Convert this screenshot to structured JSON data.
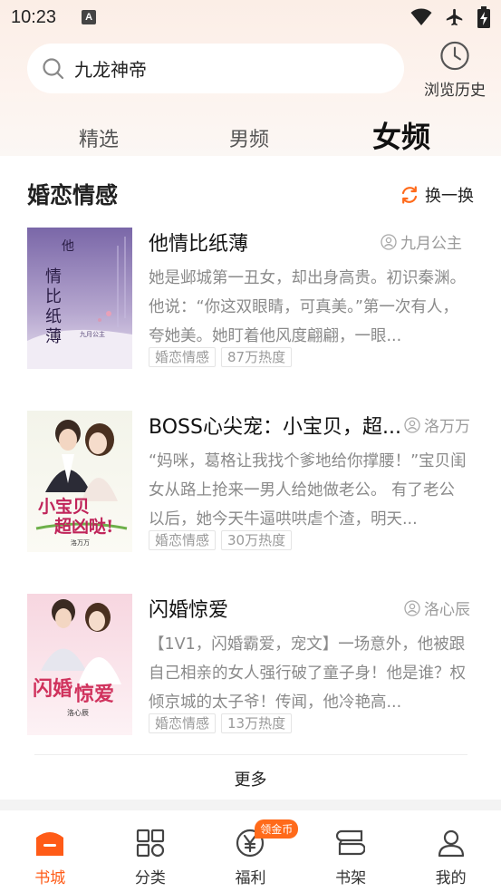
{
  "status_bar": {
    "time": "10:23",
    "notification_letter": "A"
  },
  "search": {
    "value": "九龙神帝"
  },
  "history": {
    "label": "浏览历史"
  },
  "tabs": [
    {
      "label": "精选",
      "active": false
    },
    {
      "label": "男频",
      "active": false
    },
    {
      "label": "女频",
      "active": true
    }
  ],
  "section": {
    "title": "婚恋情感",
    "refresh_label": "换一换"
  },
  "books": [
    {
      "title": "他情比纸薄",
      "author": "九月公主",
      "description": "她是邺城第一丑女，却出身高贵。初识秦渊。他说：“你这双眼睛，可真美。”第一次有人，夸她美。她盯着他风度翩翩，一眼...",
      "tags": [
        "婚恋情感",
        "87万热度"
      ],
      "cover_title": "他情比纸薄",
      "cover_author": "九月公主",
      "accent": "#8e6fae"
    },
    {
      "title": "BOSS心尖宠：小宝贝，超...",
      "author": "洛万万",
      "description": "“妈咪，葛格让我找个爹地给你撑腰！”宝贝闺女从路上抢来一男人给她做老公。 有了老公以后，她今天牛逼哄哄虐个渣，明天...",
      "tags": [
        "婚恋情感",
        "30万热度"
      ],
      "cover_title": "小宝贝超凶哒!",
      "cover_author": "洛万万",
      "accent": "#c23a6a"
    },
    {
      "title": "闪婚惊爱",
      "author": "洛心辰",
      "description": "【1V1，闪婚霸爱，宠文】一场意外，他被跟自己相亲的女人强行破了童子身！他是谁？权倾京城的太子爷！传闻，他冷艳高...",
      "tags": [
        "婚恋情感",
        "13万热度"
      ],
      "cover_title": "闪婚惊爱",
      "cover_author": "洛心辰",
      "accent": "#d0325d"
    }
  ],
  "more_label": "更多",
  "bottom_nav": [
    {
      "label": "书城",
      "icon": "bookstore-icon",
      "active": true
    },
    {
      "label": "分类",
      "icon": "category-icon",
      "active": false
    },
    {
      "label": "福利",
      "icon": "yen-coin-icon",
      "active": false,
      "badge": "领金币"
    },
    {
      "label": "书架",
      "icon": "bookshelf-icon",
      "active": false
    },
    {
      "label": "我的",
      "icon": "profile-icon",
      "active": false
    }
  ],
  "colors": {
    "accent": "#ff5b17",
    "muted_text": "#8a8a8a",
    "badge": "#ff6a1a"
  }
}
